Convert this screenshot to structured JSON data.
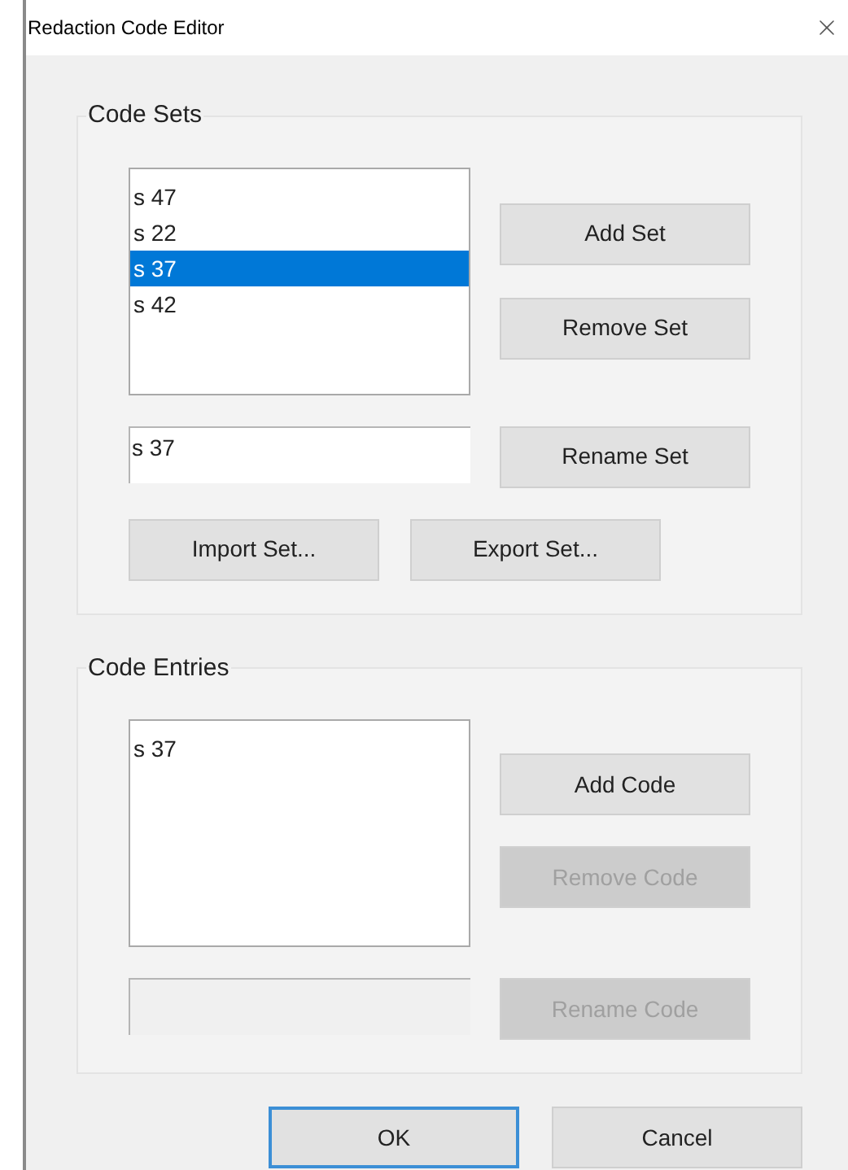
{
  "window": {
    "title": "Redaction Code Editor"
  },
  "code_sets": {
    "title": "Code Sets",
    "list": [
      {
        "label": "s 47",
        "selected": false
      },
      {
        "label": "s 22",
        "selected": false
      },
      {
        "label": "s 37",
        "selected": true
      },
      {
        "label": "s 42",
        "selected": false
      }
    ],
    "side_buttons": [
      {
        "label": "Add Set",
        "disabled": false
      },
      {
        "label": "Remove Set",
        "disabled": false
      }
    ],
    "name_field": {
      "value": "s 37",
      "disabled": false
    },
    "rename_button": {
      "label": "Rename Set",
      "disabled": false
    },
    "bottom_buttons": [
      {
        "label": "Import Set...",
        "disabled": false
      },
      {
        "label": "Export Set...",
        "disabled": false
      }
    ]
  },
  "code_entries": {
    "title": "Code Entries",
    "list": [
      {
        "label": "s 37",
        "selected": false
      }
    ],
    "side_buttons": [
      {
        "label": "Add Code",
        "disabled": false
      },
      {
        "label": "Remove Code",
        "disabled": true
      }
    ],
    "name_field": {
      "disabled": true
    },
    "rename_button": {
      "label": "Rename Code",
      "disabled": true
    }
  },
  "footer_buttons": [
    {
      "label": "OK",
      "default": true
    },
    {
      "label": "Cancel",
      "default": false
    }
  ]
}
